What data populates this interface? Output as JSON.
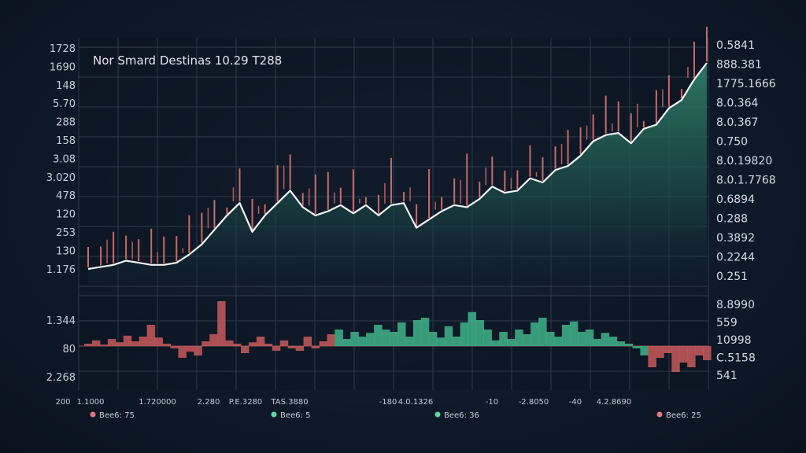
{
  "chart_data": {
    "type": "line",
    "title": "Nor Smard Destinas 10.29 T288",
    "main_left_ticks": [
      "1728",
      "1690",
      "148",
      "5.70",
      "288",
      "158",
      "3.08",
      "3.020",
      "478",
      "120",
      "253",
      "130",
      "1.176"
    ],
    "main_right_ticks": [
      "0.5841",
      "888.381",
      "1775.1666",
      "8.0.364",
      "8.0.367",
      "0.750",
      "8.0.19820",
      "8.0.1.7768",
      "0.6894",
      "0.288",
      "0.3892",
      "0.2244",
      "0.251"
    ],
    "lower_left_ticks": [
      "1.344",
      "80",
      "2.268"
    ],
    "lower_right_ticks": [
      {
        "text": "8.8990",
        "color": "#d7dce3"
      },
      {
        "text": "559",
        "color": "#6fd3a8"
      },
      {
        "text": "10998",
        "color": "#d7dce3"
      },
      {
        "text": "C.5158",
        "color": "#d7dce3"
      },
      {
        "text": "541",
        "color": "#6fd3a8"
      }
    ],
    "bottom_ticks": [
      "200",
      "1.1000",
      "1.720000",
      "2.280",
      "P.E.3280",
      "TAS.3880",
      "-180",
      "4.0.1326",
      "-10",
      "-2.8050",
      "-40",
      "4.2.8690"
    ],
    "legend": [
      {
        "label": "Bee6: 75",
        "color": "#e07b7b"
      },
      {
        "label": "Bee6: 5",
        "color": "#63d2a4"
      },
      {
        "label": "Bee6: 36",
        "color": "#63d2a4"
      },
      {
        "label": "Bee6: 25",
        "color": "#e07b7b"
      }
    ],
    "series": [
      {
        "values": [
          0.0,
          0.01,
          0.02,
          0.04,
          0.03,
          0.02,
          0.02,
          0.03,
          0.07,
          0.12,
          0.19,
          0.26,
          0.32,
          0.18,
          0.26,
          0.32,
          0.38,
          0.3,
          0.26,
          0.28,
          0.31,
          0.27,
          0.31,
          0.26,
          0.31,
          0.32,
          0.2,
          0.24,
          0.28,
          0.31,
          0.3,
          0.34,
          0.4,
          0.37,
          0.38,
          0.44,
          0.42,
          0.48,
          0.5,
          0.55,
          0.62,
          0.65,
          0.66,
          0.61,
          0.68,
          0.7,
          0.78,
          0.82,
          0.92,
          1.0
        ]
      },
      {
        "values": [
          0.05,
          0.12,
          0.03,
          0.15,
          0.08,
          0.22,
          0.1,
          0.2,
          0.45,
          0.18,
          0.05,
          -0.05,
          -0.25,
          -0.12,
          -0.2,
          0.1,
          0.25,
          0.95,
          0.12,
          0.05,
          -0.15,
          0.08,
          0.2,
          0.05,
          -0.1,
          0.12,
          -0.05,
          -0.1,
          0.2,
          -0.05,
          0.1,
          0.25,
          0.35,
          0.15,
          0.3,
          0.2,
          0.28,
          0.45,
          0.35,
          0.3,
          0.5,
          0.2,
          0.55,
          0.6,
          0.3,
          0.18,
          0.42,
          0.2,
          0.5,
          0.72,
          0.55,
          0.35,
          0.12,
          0.3,
          0.15,
          0.35,
          0.25,
          0.5,
          0.6,
          0.3,
          0.2,
          0.45,
          0.52,
          0.3,
          0.35,
          0.15,
          0.28,
          0.2,
          0.1,
          0.05,
          -0.05,
          -0.2,
          -0.45,
          -0.25,
          -0.15,
          -0.55,
          -0.35,
          -0.45,
          -0.2,
          -0.3
        ]
      }
    ]
  }
}
